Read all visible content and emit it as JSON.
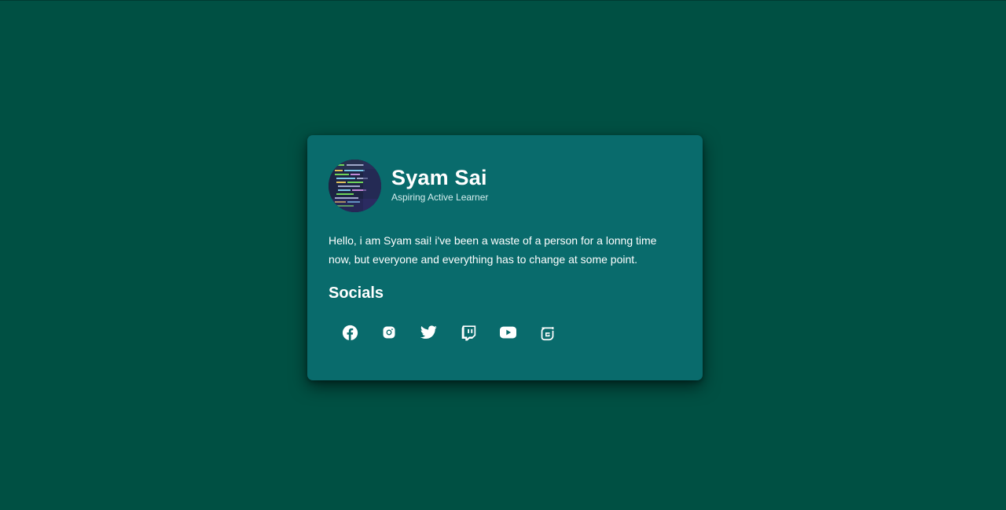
{
  "profile": {
    "name": "Syam Sai",
    "tagline": "Aspiring Active Learner",
    "avatar_icon": "code-screen-avatar"
  },
  "bio": "Hello, i am Syam sai! i've been a waste of a person for a lonng time now, but everyone and everything has to change at some point.",
  "socials": {
    "title": "Socials",
    "links": [
      {
        "icon": "facebook-icon"
      },
      {
        "icon": "instagram-icon"
      },
      {
        "icon": "twitter-icon"
      },
      {
        "icon": "twitch-icon"
      },
      {
        "icon": "youtube-icon"
      },
      {
        "icon": "guilded-icon"
      }
    ]
  },
  "colors": {
    "background": "#005043",
    "card": "#096b6c",
    "text": "#ffffff",
    "subtext": "#d6eeee"
  }
}
